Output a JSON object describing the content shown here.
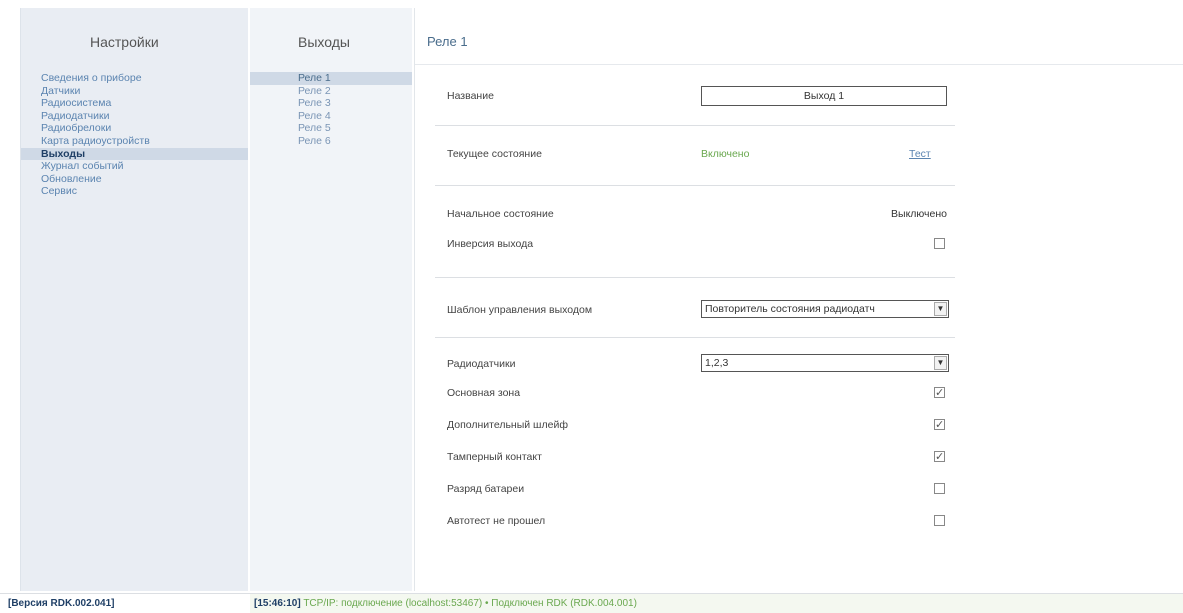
{
  "settings": {
    "title": "Настройки",
    "items": [
      {
        "label": "Сведения о приборе",
        "active": false
      },
      {
        "label": "Датчики",
        "active": false
      },
      {
        "label": "Радиосистема",
        "active": false
      },
      {
        "label": "Радиодатчики",
        "active": false
      },
      {
        "label": "Радиобрелоки",
        "active": false
      },
      {
        "label": "Карта радиоустройств",
        "active": false
      },
      {
        "label": "Выходы",
        "active": true
      },
      {
        "label": "Журнал событий",
        "active": false
      },
      {
        "label": "Обновление",
        "active": false
      },
      {
        "label": "Сервис",
        "active": false
      }
    ]
  },
  "outputs": {
    "title": "Выходы",
    "items": [
      {
        "label": "Реле 1",
        "active": true
      },
      {
        "label": "Реле 2",
        "active": false
      },
      {
        "label": "Реле 3",
        "active": false
      },
      {
        "label": "Реле 4",
        "active": false
      },
      {
        "label": "Реле 5",
        "active": false
      },
      {
        "label": "Реле 6",
        "active": false
      }
    ]
  },
  "main": {
    "title": "Реле 1",
    "name_label": "Название",
    "name_value": "Выход 1",
    "current_state_label": "Текущее состояние",
    "current_state_value": "Включено",
    "test_label": "Тест",
    "initial_state_label": "Начальное состояние",
    "initial_state_value": "Выключено",
    "inversion_label": "Инверсия выхода",
    "inversion_checked": false,
    "template_label": "Шаблон управления выходом",
    "template_value": "Повторитель состояния радиодатч",
    "sensors_label": "Радиодатчики",
    "sensors_value": "1,2,3",
    "options": [
      {
        "label": "Основная зона",
        "checked": true
      },
      {
        "label": "Дополнительный шлейф",
        "checked": true
      },
      {
        "label": "Тамперный контакт",
        "checked": true
      },
      {
        "label": "Разряд батареи",
        "checked": false
      },
      {
        "label": "Автотест не прошел",
        "checked": false
      }
    ]
  },
  "status": {
    "version": "[Версия RDK.002.041]",
    "time": "[15:46:10]",
    "log": "TCP/IP: подключение (localhost:53467) • Подключен RDK (RDK.004.001)"
  },
  "colors": {
    "accent": "#5b84b0",
    "active_bg": "#cfd9e6",
    "state_on": "#6aa84f"
  }
}
